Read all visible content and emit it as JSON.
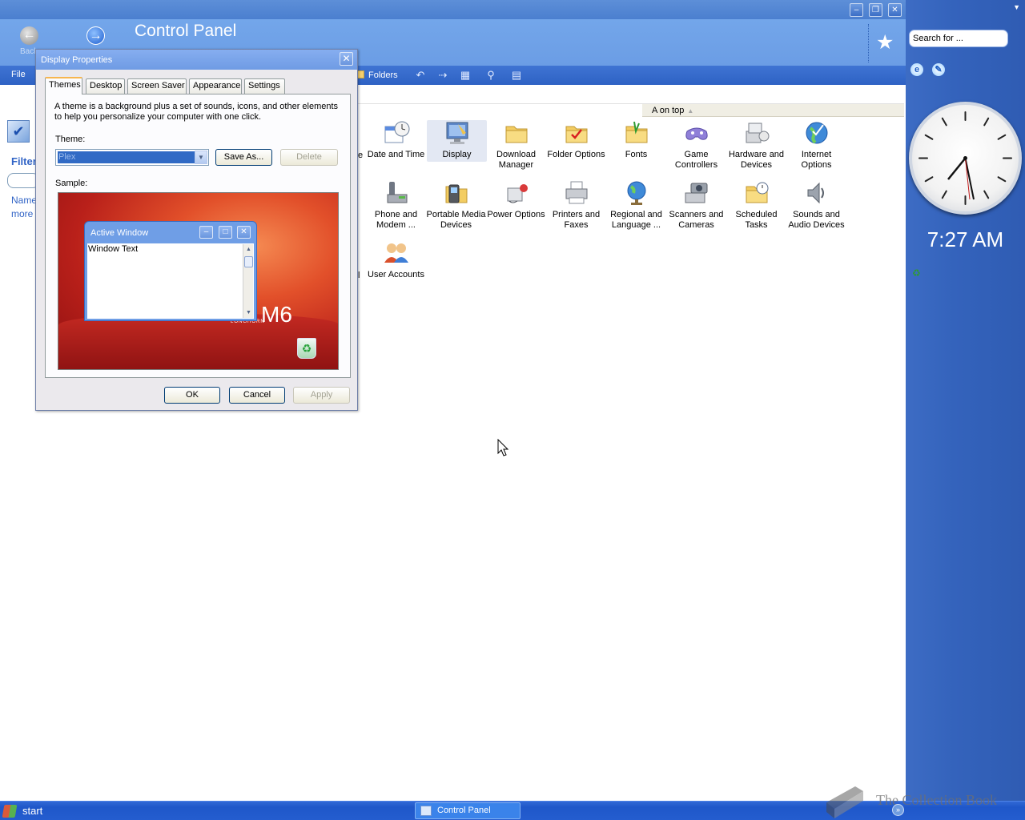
{
  "explorer": {
    "title": "Control Panel",
    "back_label": "Back",
    "menu_file": "File",
    "toolbar_folders": "Folders",
    "sort_header": "A on top",
    "left_pane": {
      "filter_label": "Filter",
      "name_label": "Name",
      "more_label": "more"
    },
    "items": [
      {
        "label": "Date and Time",
        "icon": "calendar-clock-icon"
      },
      {
        "label": "Display",
        "icon": "display-icon",
        "selected": true
      },
      {
        "label": "Download Manager",
        "icon": "folder-icon"
      },
      {
        "label": "Folder Options",
        "icon": "folder-check-icon"
      },
      {
        "label": "Fonts",
        "icon": "fonts-folder-icon"
      },
      {
        "label": "Game Controllers",
        "icon": "gamepad-icon"
      },
      {
        "label": "Hardware and Devices",
        "icon": "hardware-icon"
      },
      {
        "label": "Internet Options",
        "icon": "globe-icon"
      },
      {
        "label": "Phone and Modem ...",
        "icon": "phone-icon"
      },
      {
        "label": "Portable Media Devices",
        "icon": "media-device-icon"
      },
      {
        "label": "Power Options",
        "icon": "power-icon"
      },
      {
        "label": "Printers and Faxes",
        "icon": "printer-icon"
      },
      {
        "label": "Regional and Language ...",
        "icon": "globe-stand-icon"
      },
      {
        "label": "Scanners and Cameras",
        "icon": "scanner-icon"
      },
      {
        "label": "Scheduled Tasks",
        "icon": "scheduled-folder-icon"
      },
      {
        "label": "Sounds and Audio Devices",
        "icon": "speaker-icon"
      },
      {
        "label": "User Accounts",
        "icon": "users-icon"
      }
    ],
    "partial_labels": [
      "e",
      "l"
    ]
  },
  "sidebar": {
    "search_placeholder": "Search for ...",
    "clock_time": "7:27 AM"
  },
  "dialog": {
    "title": "Display Properties",
    "tabs": [
      "Themes",
      "Desktop",
      "Screen Saver",
      "Appearance",
      "Settings"
    ],
    "active_tab": "Themes",
    "description": "A theme is a background plus a set of sounds, icons, and other elements to help you personalize your computer with one click.",
    "theme_label": "Theme:",
    "theme_value": "Plex",
    "save_as": "Save As...",
    "delete": "Delete",
    "sample_label": "Sample:",
    "sample": {
      "active_window_title": "Active Window",
      "window_text": "Window Text",
      "wallpaper_text": "M6",
      "wallpaper_brand": "LONGHORN"
    },
    "ok": "OK",
    "cancel": "Cancel",
    "apply": "Apply"
  },
  "taskbar": {
    "start_label": "start",
    "task_control_panel": "Control Panel",
    "watermark": "The Collection Book"
  },
  "colors": {
    "explorer_header": "#73a6ea",
    "toolbar": "#3f74d3",
    "sidebar": "#3463bc",
    "taskbar": "#245dcf",
    "selection": "#316ac5"
  }
}
